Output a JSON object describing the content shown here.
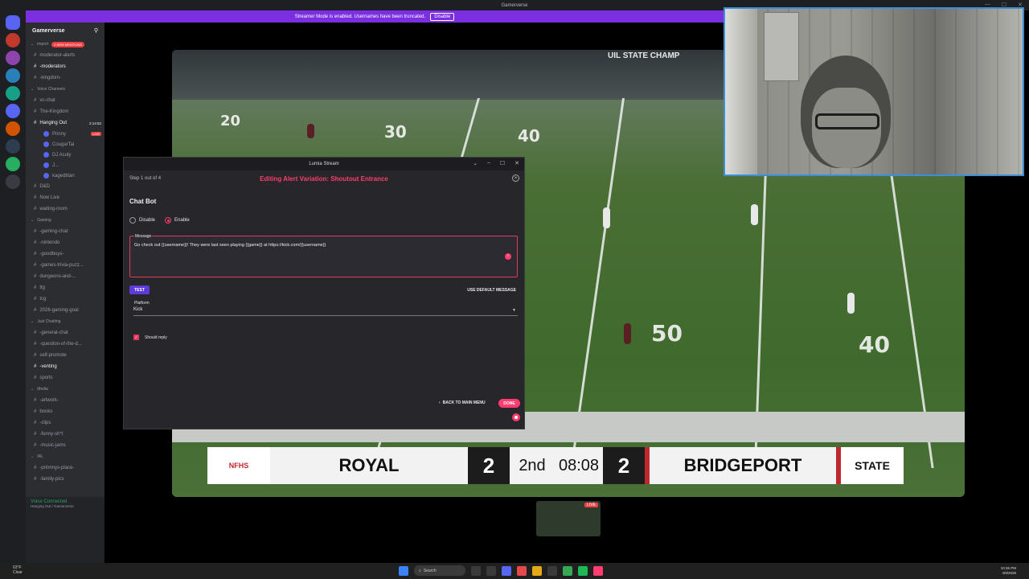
{
  "titlebar": {
    "title": "Gamerverse"
  },
  "banner": {
    "text": "Streamer Mode is enabled. Usernames have been truncated.",
    "button": "Disable"
  },
  "sidebar": {
    "server_name": "Gamerverse",
    "mentions_badge": "2 NEW MENTIONS",
    "rows": [
      {
        "kind": "cat",
        "label": "import"
      },
      {
        "kind": "ch",
        "label": "moderator-alerts"
      },
      {
        "kind": "ch",
        "label": "-moderators",
        "bright": true
      },
      {
        "kind": "ch",
        "label": "-kingdom-"
      },
      {
        "kind": "cat",
        "label": "Voice Channels"
      },
      {
        "kind": "ch",
        "label": "vc-chat"
      },
      {
        "kind": "ch",
        "label": "The-Kingdom"
      },
      {
        "kind": "ch",
        "label": "Hanging Out",
        "bright": true,
        "extra": "2:14:52"
      },
      {
        "kind": "user",
        "label": "Prinny",
        "live": true
      },
      {
        "kind": "user",
        "label": "CougarTai"
      },
      {
        "kind": "user",
        "label": "DJ Aculy"
      },
      {
        "kind": "user",
        "label": "J..."
      },
      {
        "kind": "user",
        "label": "kagedtitan"
      },
      {
        "kind": "ch",
        "label": "D&D"
      },
      {
        "kind": "ch",
        "label": "Now Live"
      },
      {
        "kind": "ch",
        "label": "waiting-room"
      },
      {
        "kind": "cat",
        "label": "Gaming"
      },
      {
        "kind": "ch",
        "label": "-gaming-chat"
      },
      {
        "kind": "ch",
        "label": "-nintendo"
      },
      {
        "kind": "ch",
        "label": "-goodbuys-"
      },
      {
        "kind": "ch",
        "label": "-games-trivia-puzz..."
      },
      {
        "kind": "ch",
        "label": "dungeons-and-..."
      },
      {
        "kind": "ch",
        "label": "ttg"
      },
      {
        "kind": "ch",
        "label": "tcg"
      },
      {
        "kind": "ch",
        "label": "2026-gaming-goal"
      },
      {
        "kind": "cat",
        "label": "Just Chatting"
      },
      {
        "kind": "ch",
        "label": "-general-chat"
      },
      {
        "kind": "ch",
        "label": "-question-of-the-d..."
      },
      {
        "kind": "ch",
        "label": "self-promote"
      },
      {
        "kind": "ch",
        "label": "-venting",
        "bright": true
      },
      {
        "kind": "ch",
        "label": "sports"
      },
      {
        "kind": "cat",
        "label": "Media"
      },
      {
        "kind": "ch",
        "label": "-artwork-"
      },
      {
        "kind": "ch",
        "label": "books"
      },
      {
        "kind": "ch",
        "label": "-clips"
      },
      {
        "kind": "ch",
        "label": "-funny-sh*t"
      },
      {
        "kind": "ch",
        "label": "-music-jams"
      },
      {
        "kind": "cat",
        "label": "IRL"
      },
      {
        "kind": "ch",
        "label": "-prinnnys-place-"
      },
      {
        "kind": "ch",
        "label": "-family-pics"
      }
    ],
    "voice_connected": "Voice Connected",
    "voice_sub": "Hanging Out / Gamerverse"
  },
  "scoreboard": {
    "home": "ROYAL",
    "home_score": "2",
    "period": "2nd",
    "clock": "08:08",
    "away_score": "2",
    "away": "BRIDGEPORT",
    "right_logo": "STATE"
  },
  "field": {
    "stands_banner": "UIL STATE CHAMP",
    "yard_numbers": [
      "20",
      "30",
      "40",
      "50",
      "40"
    ]
  },
  "mini_preview": {
    "badge": "LIVE"
  },
  "lumia": {
    "window_title": "Lumia Stream",
    "step": "Step 1 out of 4",
    "heading": "Editing Alert Variation: Shoutout Entrance",
    "section": "Chat Bot",
    "disable_label": "Disable",
    "enable_label": "Enable",
    "message_label": "Message",
    "message_value": "Go check out {{username}}! They were last seen playing {{game}} at https://kick.com/{{username}}",
    "test_label": "TEST",
    "default_label": "USE DEFAULT MESSAGE",
    "platform_label": "Platform",
    "platform_value": "Kick",
    "should_reply": "Should reply",
    "back_label": "BACK TO MAIN MENU",
    "done_label": "DONE"
  },
  "taskbar": {
    "weather_temp": "63°F",
    "weather_cond": "Clear",
    "search": "Search",
    "time": "10:36 PM",
    "date": "4/9/2026"
  },
  "colors": {
    "accent": "#ff3d6f",
    "banner": "#7b2fe0",
    "discord_bg": "#2b2d31"
  }
}
